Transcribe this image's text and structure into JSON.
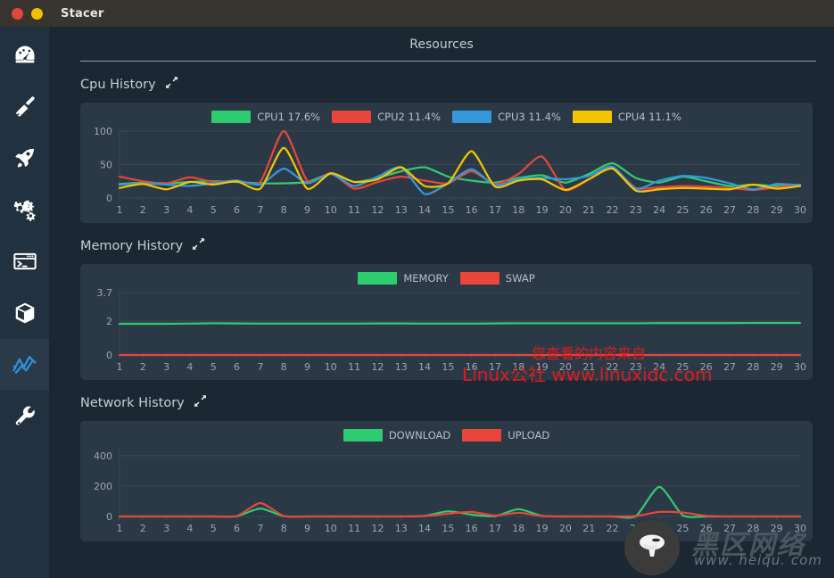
{
  "window": {
    "app_title": "Stacer",
    "controls": [
      {
        "name": "close",
        "color": "#e0483c"
      },
      {
        "name": "minimize",
        "color": "#f0c000"
      }
    ]
  },
  "sidebar": {
    "items": [
      {
        "id": "dashboard",
        "icon": "gauge-icon",
        "active": false
      },
      {
        "id": "system-cleaner",
        "icon": "brush-icon",
        "active": false
      },
      {
        "id": "startup-apps",
        "icon": "rocket-icon",
        "active": false
      },
      {
        "id": "services",
        "icon": "gears-icon",
        "active": false
      },
      {
        "id": "processes",
        "icon": "terminal-icon",
        "active": false
      },
      {
        "id": "uninstaller",
        "icon": "box-icon",
        "active": false
      },
      {
        "id": "resources",
        "icon": "line-chart-icon",
        "active": true
      },
      {
        "id": "settings",
        "icon": "wrench-icon",
        "active": false
      }
    ]
  },
  "header": {
    "title": "Resources"
  },
  "sections": [
    {
      "id": "cpu",
      "title": "Cpu History",
      "expand_icon": "expand-diagonal-icon"
    },
    {
      "id": "memory",
      "title": "Memory History",
      "expand_icon": "expand-diagonal-icon"
    },
    {
      "id": "network",
      "title": "Network History",
      "expand_icon": "expand-diagonal-icon"
    }
  ],
  "colors": {
    "green": "#2ecc71",
    "red": "#e8463a",
    "blue": "#3498db",
    "yellow": "#f2c500",
    "panel": "#2b3947",
    "background": "#1b2733",
    "sidebar": "#22313f",
    "sidebar_active": "#2b3a48",
    "titlebar": "#383430",
    "text": "#c3ccd4",
    "axis_text": "#9aa5ae",
    "grid": "#3a4855",
    "accent_blue": "#2f8fd4"
  },
  "watermarks": {
    "line1": "您查看的内容来自",
    "line2": "Linux公社 www.linuxidc.com",
    "brand": "黑区网络",
    "brand_url": "www. heiqu. com",
    "logo_icon": "mushroom-icon"
  },
  "chart_data": [
    {
      "id": "cpu",
      "type": "line",
      "title": "Cpu History",
      "xlabel": "",
      "ylabel": "",
      "ylim": [
        0,
        100
      ],
      "yticks": [
        0,
        50,
        100
      ],
      "ytick_labels": [
        "0",
        "50",
        "100"
      ],
      "x": [
        1,
        2,
        3,
        4,
        5,
        6,
        7,
        8,
        9,
        10,
        11,
        12,
        13,
        14,
        15,
        16,
        17,
        18,
        19,
        20,
        21,
        22,
        23,
        24,
        25,
        26,
        27,
        28,
        29,
        30
      ],
      "xtick_labels": [
        "1",
        "2",
        "3",
        "4",
        "5",
        "6",
        "7",
        "8",
        "9",
        "10",
        "11",
        "12",
        "13",
        "14",
        "15",
        "16",
        "17",
        "18",
        "19",
        "20",
        "21",
        "22",
        "23",
        "24",
        "25",
        "26",
        "27",
        "28",
        "29",
        "30"
      ],
      "grid": true,
      "legend_position": "top-center",
      "series": [
        {
          "name": "CPU1",
          "label": "CPU1 17.6%",
          "color": "#2ecc71",
          "values": [
            21,
            23,
            22,
            24,
            25,
            24,
            22,
            22,
            24,
            36,
            24,
            30,
            40,
            46,
            32,
            26,
            23,
            30,
            34,
            23,
            36,
            52,
            30,
            23,
            32,
            25,
            18,
            20,
            18,
            20
          ]
        },
        {
          "name": "CPU2",
          "label": "CPU2 11.4%",
          "color": "#e8463a",
          "values": [
            32,
            25,
            22,
            31,
            24,
            26,
            24,
            100,
            26,
            37,
            14,
            24,
            32,
            26,
            22,
            40,
            21,
            36,
            62,
            12,
            28,
            45,
            15,
            16,
            18,
            17,
            15,
            12,
            16,
            20
          ]
        },
        {
          "name": "CPU3",
          "label": "CPU3 11.4%",
          "color": "#3498db",
          "values": [
            20,
            22,
            20,
            18,
            22,
            26,
            20,
            44,
            22,
            36,
            18,
            32,
            46,
            6,
            22,
            43,
            19,
            28,
            30,
            28,
            33,
            47,
            14,
            26,
            33,
            30,
            22,
            13,
            21,
            19
          ]
        },
        {
          "name": "CPU4",
          "label": "CPU4 11.1%",
          "color": "#f2c500",
          "values": [
            15,
            21,
            13,
            24,
            20,
            25,
            14,
            75,
            14,
            37,
            24,
            28,
            46,
            18,
            22,
            70,
            17,
            26,
            28,
            12,
            28,
            44,
            11,
            13,
            15,
            14,
            13,
            20,
            14,
            18
          ]
        }
      ]
    },
    {
      "id": "memory",
      "type": "line",
      "title": "Memory History",
      "xlabel": "",
      "ylabel": "",
      "ylim": [
        0,
        3.7
      ],
      "yticks": [
        0,
        2,
        3.7
      ],
      "ytick_labels": [
        "0",
        "2",
        "3.7"
      ],
      "x": [
        1,
        2,
        3,
        4,
        5,
        6,
        7,
        8,
        9,
        10,
        11,
        12,
        13,
        14,
        15,
        16,
        17,
        18,
        19,
        20,
        21,
        22,
        23,
        24,
        25,
        26,
        27,
        28,
        29,
        30
      ],
      "xtick_labels": [
        "1",
        "2",
        "3",
        "4",
        "5",
        "6",
        "7",
        "8",
        "9",
        "10",
        "11",
        "12",
        "13",
        "14",
        "15",
        "16",
        "17",
        "18",
        "19",
        "20",
        "21",
        "22",
        "23",
        "24",
        "25",
        "26",
        "27",
        "28",
        "29",
        "30"
      ],
      "grid": true,
      "legend_position": "top-center",
      "series": [
        {
          "name": "MEMORY",
          "label": "MEMORY",
          "color": "#2ecc71",
          "values": [
            1.85,
            1.85,
            1.85,
            1.86,
            1.88,
            1.87,
            1.86,
            1.86,
            1.86,
            1.86,
            1.86,
            1.87,
            1.87,
            1.86,
            1.86,
            1.86,
            1.87,
            1.88,
            1.88,
            1.88,
            1.88,
            1.88,
            1.88,
            1.89,
            1.89,
            1.89,
            1.89,
            1.9,
            1.9,
            1.9
          ]
        },
        {
          "name": "SWAP",
          "label": "SWAP",
          "color": "#e8463a",
          "values": [
            0,
            0,
            0,
            0,
            0,
            0,
            0,
            0,
            0,
            0,
            0,
            0,
            0,
            0,
            0,
            0,
            0,
            0,
            0,
            0,
            0,
            0,
            0,
            0,
            0,
            0,
            0,
            0,
            0,
            0
          ]
        }
      ]
    },
    {
      "id": "network",
      "type": "line",
      "title": "Network History",
      "xlabel": "",
      "ylabel": "",
      "ylim": [
        0,
        440
      ],
      "yticks": [
        0,
        200,
        400
      ],
      "ytick_labels": [
        "0",
        "200",
        "400"
      ],
      "x": [
        1,
        2,
        3,
        4,
        5,
        6,
        7,
        8,
        9,
        10,
        11,
        12,
        13,
        14,
        15,
        16,
        17,
        18,
        19,
        20,
        21,
        22,
        23,
        24,
        25,
        26,
        27,
        28,
        29,
        30
      ],
      "xtick_labels": [
        "1",
        "2",
        "3",
        "4",
        "5",
        "6",
        "7",
        "8",
        "9",
        "10",
        "11",
        "12",
        "13",
        "14",
        "15",
        "16",
        "17",
        "18",
        "19",
        "20",
        "21",
        "22",
        "23",
        "24",
        "25",
        "26",
        "27",
        "28",
        "29",
        "30"
      ],
      "grid": true,
      "legend_position": "top-center",
      "series": [
        {
          "name": "DOWNLOAD",
          "label": "DOWNLOAD",
          "color": "#2ecc71",
          "values": [
            0,
            0,
            0,
            0,
            0,
            2,
            52,
            2,
            0,
            0,
            0,
            0,
            0,
            4,
            34,
            12,
            2,
            48,
            4,
            0,
            0,
            0,
            2,
            195,
            8,
            0,
            0,
            0,
            0,
            0
          ]
        },
        {
          "name": "UPLOAD",
          "label": "UPLOAD",
          "color": "#e8463a",
          "values": [
            0,
            0,
            0,
            0,
            0,
            3,
            88,
            3,
            0,
            0,
            0,
            0,
            0,
            3,
            18,
            30,
            6,
            24,
            3,
            0,
            0,
            0,
            3,
            30,
            26,
            4,
            0,
            0,
            0,
            0
          ]
        }
      ]
    }
  ]
}
